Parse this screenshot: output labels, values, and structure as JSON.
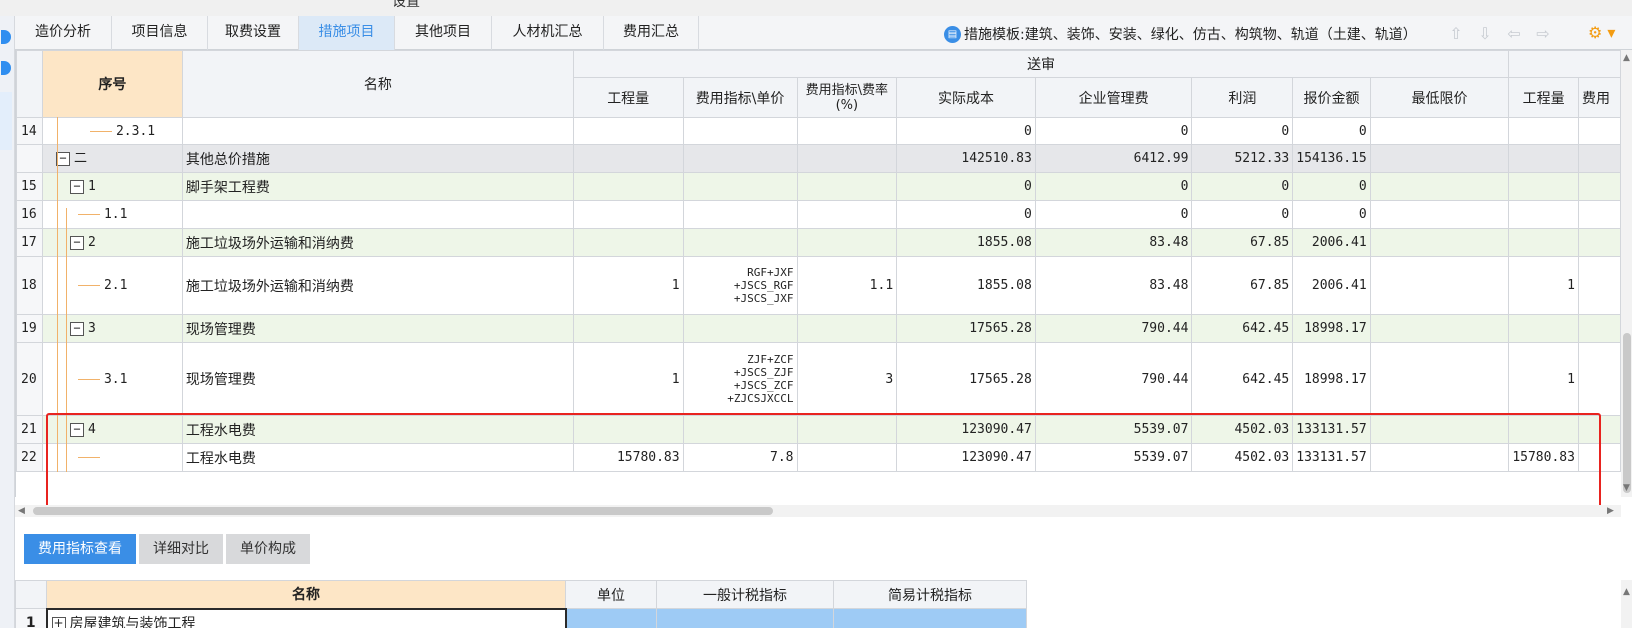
{
  "window": {
    "partial_title": "设置"
  },
  "tabs": [
    "造价分析",
    "项目信息",
    "取费设置",
    "措施项目",
    "其他项目",
    "人材机汇总",
    "费用汇总"
  ],
  "active_tab": "措施项目",
  "template_label": "措施模板:建筑、装饰、安装、绿化、仿古、构筑物、轨道（土建、轨道）",
  "icons": [
    "move-up-icon",
    "move-down-icon",
    "move-left-icon",
    "move-right-icon",
    "gear-icon"
  ],
  "colors": {
    "accent": "#3a8ee6",
    "header_highlight": "#fde6c6",
    "group_row": "#eef6e8",
    "annotation_box": "#e8231f"
  },
  "grid": {
    "header": {
      "seq": "序号",
      "name": "名称",
      "group_label": "送审",
      "columns": [
        "工程量",
        "费用指标\\单价",
        "费用指标\\费率(%)",
        "实际成本",
        "企业管理费",
        "利润",
        "报价金额",
        "最低限价",
        "工程量",
        "费用"
      ]
    },
    "rows": [
      {
        "rn": "14",
        "seq": "2.3.1",
        "name": "",
        "qty": "",
        "unit": "",
        "rate": "",
        "cost": "0",
        "mgmt": "0",
        "profit": "0",
        "quote": "0",
        "min": "",
        "qty2": "",
        "fee2": ""
      },
      {
        "rn": "",
        "seq": "二",
        "name": "其他总价措施",
        "qty": "",
        "unit": "",
        "rate": "",
        "cost": "142510.83",
        "mgmt": "6412.99",
        "profit": "5212.33",
        "quote": "154136.15",
        "min": "",
        "qty2": "",
        "fee2": ""
      },
      {
        "rn": "15",
        "seq": "1",
        "name": "脚手架工程费",
        "qty": "",
        "unit": "",
        "rate": "",
        "cost": "0",
        "mgmt": "0",
        "profit": "0",
        "quote": "0",
        "min": "",
        "qty2": "",
        "fee2": ""
      },
      {
        "rn": "16",
        "seq": "1.1",
        "name": "",
        "qty": "",
        "unit": "",
        "rate": "",
        "cost": "0",
        "mgmt": "0",
        "profit": "0",
        "quote": "0",
        "min": "",
        "qty2": "",
        "fee2": ""
      },
      {
        "rn": "17",
        "seq": "2",
        "name": "施工垃圾场外运输和消纳费",
        "qty": "",
        "unit": "",
        "rate": "",
        "cost": "1855.08",
        "mgmt": "83.48",
        "profit": "67.85",
        "quote": "2006.41",
        "min": "",
        "qty2": "",
        "fee2": ""
      },
      {
        "rn": "18",
        "seq": "2.1",
        "name": "施工垃圾场外运输和消纳费",
        "qty": "1",
        "unit_lines": [
          "RGF+JXF",
          "+JSCS_RGF",
          "+JSCS_JXF"
        ],
        "rate": "1.1",
        "cost": "1855.08",
        "mgmt": "83.48",
        "profit": "67.85",
        "quote": "2006.41",
        "min": "",
        "qty2": "1",
        "fee2": ""
      },
      {
        "rn": "19",
        "seq": "3",
        "name": "现场管理费",
        "qty": "",
        "unit": "",
        "rate": "",
        "cost": "17565.28",
        "mgmt": "790.44",
        "profit": "642.45",
        "quote": "18998.17",
        "min": "",
        "qty2": "",
        "fee2": ""
      },
      {
        "rn": "20",
        "seq": "3.1",
        "name": "现场管理费",
        "qty": "1",
        "unit_lines": [
          "ZJF+ZCF",
          "+JSCS_ZJF",
          "+JSCS_ZCF",
          "+ZJCSJXCCL"
        ],
        "rate": "3",
        "cost": "17565.28",
        "mgmt": "790.44",
        "profit": "642.45",
        "quote": "18998.17",
        "min": "",
        "qty2": "1",
        "fee2": ""
      },
      {
        "rn": "21",
        "seq": "4",
        "name": "工程水电费",
        "qty": "",
        "unit": "",
        "rate": "",
        "cost": "123090.47",
        "mgmt": "5539.07",
        "profit": "4502.03",
        "quote": "133131.57",
        "min": "",
        "qty2": "",
        "fee2": ""
      },
      {
        "rn": "22",
        "seq": "",
        "name": "工程水电费",
        "qty": "15780.83",
        "unit": "7.8",
        "rate": "",
        "cost": "123090.47",
        "mgmt": "5539.07",
        "profit": "4502.03",
        "quote": "133131.57",
        "min": "",
        "qty2": "15780.83",
        "fee2": ""
      }
    ]
  },
  "bottom_tabs": [
    "费用指标查看",
    "详细对比",
    "单价构成"
  ],
  "bottom_active": "费用指标查看",
  "sub_table": {
    "columns": [
      "名称",
      "单位",
      "一般计税指标",
      "简易计税指标"
    ],
    "rows": [
      {
        "rn": "1",
        "name": "房屋建筑与装饰工程",
        "unit": "",
        "general": "",
        "simple": ""
      }
    ]
  }
}
